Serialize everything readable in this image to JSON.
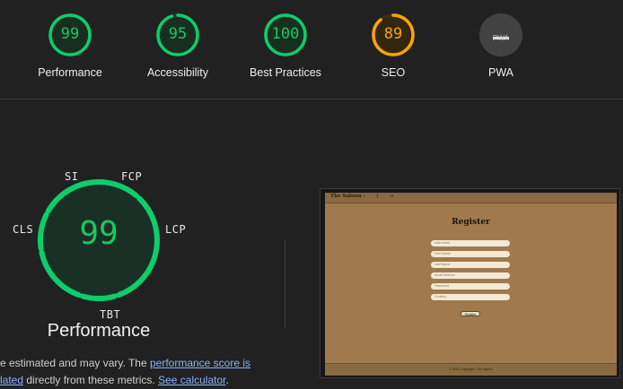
{
  "categories": [
    {
      "name": "Performance",
      "score": "99",
      "value": 99,
      "color": "#0cce6b"
    },
    {
      "name": "Accessibility",
      "score": "95",
      "value": 95,
      "color": "#0cce6b"
    },
    {
      "name": "Best Practices",
      "score": "100",
      "value": 100,
      "color": "#0cce6b"
    },
    {
      "name": "SEO",
      "score": "89",
      "value": 89,
      "color": "#ffa400"
    },
    {
      "name": "PWA",
      "score": "PWA",
      "value": null,
      "color": "#9e9e9e"
    }
  ],
  "performance": {
    "score": "99",
    "value": 99,
    "title": "Performance",
    "metrics": [
      "SI",
      "FCP",
      "LCP",
      "TBT",
      "CLS"
    ],
    "description": {
      "line1_prefix": "e estimated and may vary. The ",
      "line1_link": "performance score is",
      "line2_link": "lated",
      "line2_middle": " directly from these metrics. ",
      "line2_link2": "See calculator",
      "line2_suffix": "."
    }
  },
  "screenshot": {
    "nav": {
      "brand": "The Saloon",
      "items": [
        "⌂",
        "1",
        "⇥"
      ]
    },
    "title": "Register",
    "fields": [
      "Username",
      "First Name",
      "Last Name",
      "Email Address",
      "Password",
      "Confirm"
    ],
    "button": "Register",
    "footer": "© 2022 Copyright: The Saloon"
  },
  "colors": {
    "pass": "#0cce6b",
    "average": "#ffa400",
    "background": "#212121"
  }
}
